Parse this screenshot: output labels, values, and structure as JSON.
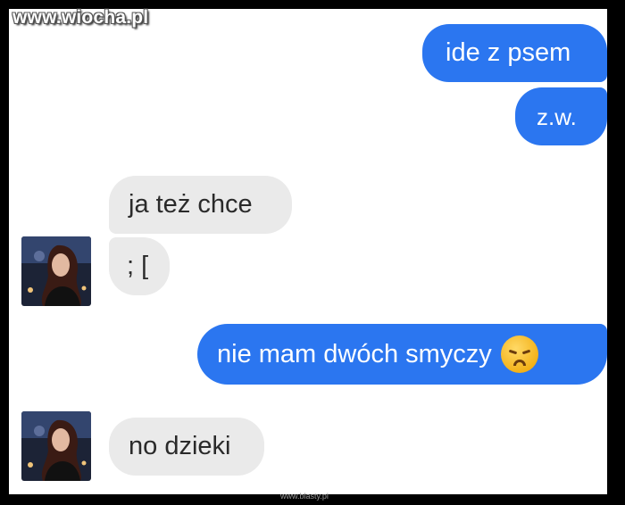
{
  "watermark": {
    "top": "www.wiocha.pl",
    "bottom": "www.blasty.pl"
  },
  "colors": {
    "outgoing": "#2b76f0",
    "incoming": "#eaeaea"
  },
  "messages": [
    {
      "direction": "out",
      "text": "ide z psem"
    },
    {
      "direction": "out",
      "text": "z.w."
    },
    {
      "direction": "in",
      "text": "ja też chce"
    },
    {
      "direction": "in",
      "text": "; ["
    },
    {
      "direction": "out",
      "text": "nie mam dwóch smyczy",
      "emoji": "disappointed-face-icon"
    },
    {
      "direction": "in",
      "text": "no dzieki"
    }
  ]
}
